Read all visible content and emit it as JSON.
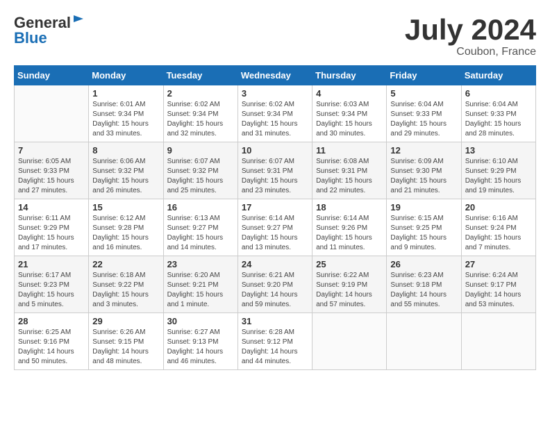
{
  "header": {
    "logo": {
      "general": "General",
      "blue": "Blue"
    },
    "title": "July 2024",
    "location": "Coubon, France"
  },
  "weekdays": [
    "Sunday",
    "Monday",
    "Tuesday",
    "Wednesday",
    "Thursday",
    "Friday",
    "Saturday"
  ],
  "weeks": [
    [
      {
        "day": "",
        "info": ""
      },
      {
        "day": "1",
        "info": "Sunrise: 6:01 AM\nSunset: 9:34 PM\nDaylight: 15 hours\nand 33 minutes."
      },
      {
        "day": "2",
        "info": "Sunrise: 6:02 AM\nSunset: 9:34 PM\nDaylight: 15 hours\nand 32 minutes."
      },
      {
        "day": "3",
        "info": "Sunrise: 6:02 AM\nSunset: 9:34 PM\nDaylight: 15 hours\nand 31 minutes."
      },
      {
        "day": "4",
        "info": "Sunrise: 6:03 AM\nSunset: 9:34 PM\nDaylight: 15 hours\nand 30 minutes."
      },
      {
        "day": "5",
        "info": "Sunrise: 6:04 AM\nSunset: 9:33 PM\nDaylight: 15 hours\nand 29 minutes."
      },
      {
        "day": "6",
        "info": "Sunrise: 6:04 AM\nSunset: 9:33 PM\nDaylight: 15 hours\nand 28 minutes."
      }
    ],
    [
      {
        "day": "7",
        "info": "Sunrise: 6:05 AM\nSunset: 9:33 PM\nDaylight: 15 hours\nand 27 minutes."
      },
      {
        "day": "8",
        "info": "Sunrise: 6:06 AM\nSunset: 9:32 PM\nDaylight: 15 hours\nand 26 minutes."
      },
      {
        "day": "9",
        "info": "Sunrise: 6:07 AM\nSunset: 9:32 PM\nDaylight: 15 hours\nand 25 minutes."
      },
      {
        "day": "10",
        "info": "Sunrise: 6:07 AM\nSunset: 9:31 PM\nDaylight: 15 hours\nand 23 minutes."
      },
      {
        "day": "11",
        "info": "Sunrise: 6:08 AM\nSunset: 9:31 PM\nDaylight: 15 hours\nand 22 minutes."
      },
      {
        "day": "12",
        "info": "Sunrise: 6:09 AM\nSunset: 9:30 PM\nDaylight: 15 hours\nand 21 minutes."
      },
      {
        "day": "13",
        "info": "Sunrise: 6:10 AM\nSunset: 9:29 PM\nDaylight: 15 hours\nand 19 minutes."
      }
    ],
    [
      {
        "day": "14",
        "info": "Sunrise: 6:11 AM\nSunset: 9:29 PM\nDaylight: 15 hours\nand 17 minutes."
      },
      {
        "day": "15",
        "info": "Sunrise: 6:12 AM\nSunset: 9:28 PM\nDaylight: 15 hours\nand 16 minutes."
      },
      {
        "day": "16",
        "info": "Sunrise: 6:13 AM\nSunset: 9:27 PM\nDaylight: 15 hours\nand 14 minutes."
      },
      {
        "day": "17",
        "info": "Sunrise: 6:14 AM\nSunset: 9:27 PM\nDaylight: 15 hours\nand 13 minutes."
      },
      {
        "day": "18",
        "info": "Sunrise: 6:14 AM\nSunset: 9:26 PM\nDaylight: 15 hours\nand 11 minutes."
      },
      {
        "day": "19",
        "info": "Sunrise: 6:15 AM\nSunset: 9:25 PM\nDaylight: 15 hours\nand 9 minutes."
      },
      {
        "day": "20",
        "info": "Sunrise: 6:16 AM\nSunset: 9:24 PM\nDaylight: 15 hours\nand 7 minutes."
      }
    ],
    [
      {
        "day": "21",
        "info": "Sunrise: 6:17 AM\nSunset: 9:23 PM\nDaylight: 15 hours\nand 5 minutes."
      },
      {
        "day": "22",
        "info": "Sunrise: 6:18 AM\nSunset: 9:22 PM\nDaylight: 15 hours\nand 3 minutes."
      },
      {
        "day": "23",
        "info": "Sunrise: 6:20 AM\nSunset: 9:21 PM\nDaylight: 15 hours\nand 1 minute."
      },
      {
        "day": "24",
        "info": "Sunrise: 6:21 AM\nSunset: 9:20 PM\nDaylight: 14 hours\nand 59 minutes."
      },
      {
        "day": "25",
        "info": "Sunrise: 6:22 AM\nSunset: 9:19 PM\nDaylight: 14 hours\nand 57 minutes."
      },
      {
        "day": "26",
        "info": "Sunrise: 6:23 AM\nSunset: 9:18 PM\nDaylight: 14 hours\nand 55 minutes."
      },
      {
        "day": "27",
        "info": "Sunrise: 6:24 AM\nSunset: 9:17 PM\nDaylight: 14 hours\nand 53 minutes."
      }
    ],
    [
      {
        "day": "28",
        "info": "Sunrise: 6:25 AM\nSunset: 9:16 PM\nDaylight: 14 hours\nand 50 minutes."
      },
      {
        "day": "29",
        "info": "Sunrise: 6:26 AM\nSunset: 9:15 PM\nDaylight: 14 hours\nand 48 minutes."
      },
      {
        "day": "30",
        "info": "Sunrise: 6:27 AM\nSunset: 9:13 PM\nDaylight: 14 hours\nand 46 minutes."
      },
      {
        "day": "31",
        "info": "Sunrise: 6:28 AM\nSunset: 9:12 PM\nDaylight: 14 hours\nand 44 minutes."
      },
      {
        "day": "",
        "info": ""
      },
      {
        "day": "",
        "info": ""
      },
      {
        "day": "",
        "info": ""
      }
    ]
  ]
}
